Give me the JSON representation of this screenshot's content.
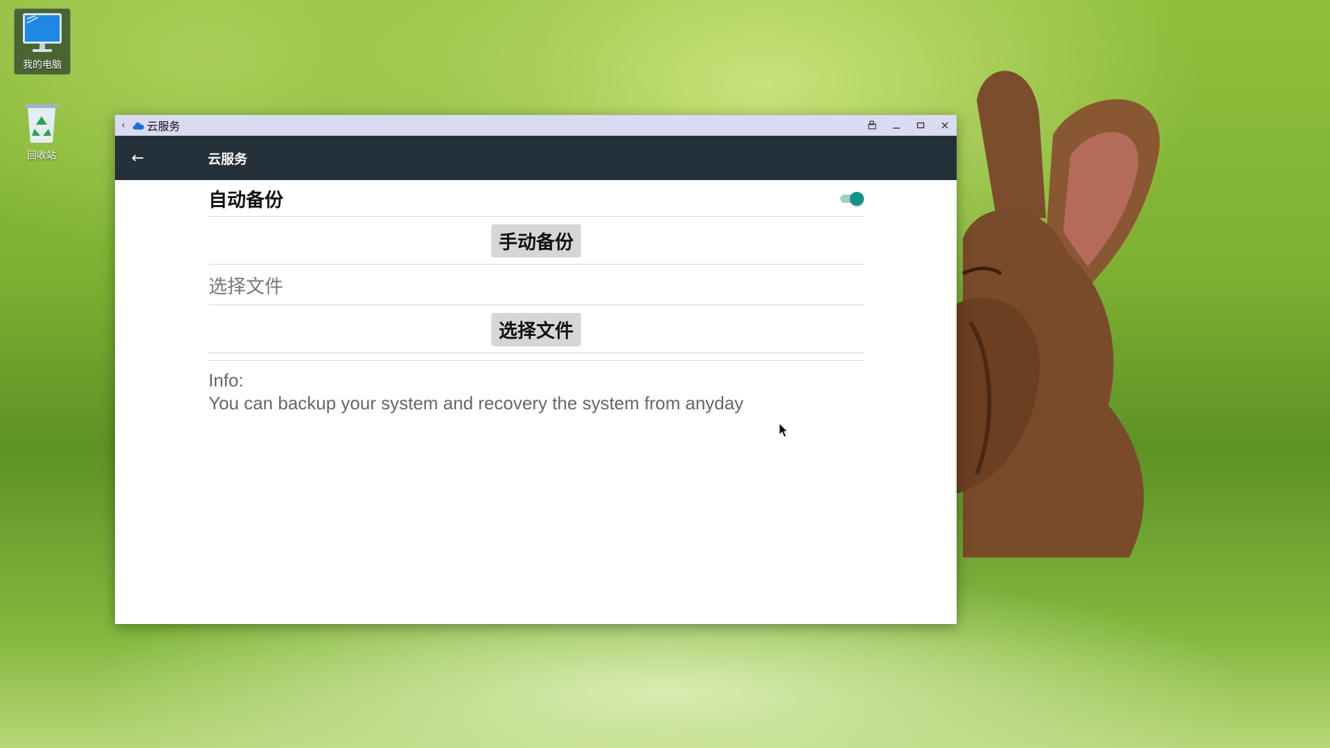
{
  "desktop": {
    "icons": [
      {
        "label": "我的电脑",
        "icon": "computer-icon"
      },
      {
        "label": "回收站",
        "icon": "recycle-bin-icon"
      }
    ]
  },
  "window": {
    "titlebar": {
      "title": "云服务",
      "back_icon": "chevron-left-icon",
      "app_icon": "cloud-icon",
      "buttons": [
        "rotate-icon",
        "minimize-icon",
        "maximize-icon",
        "close-icon"
      ]
    },
    "appbar": {
      "title": "云服务",
      "back_icon": "arrow-left-icon",
      "color": "#25313a"
    },
    "settings": {
      "auto_backup_label": "自动备份",
      "auto_backup_enabled": true,
      "manual_backup_button": "手动备份",
      "select_file_label": "选择文件",
      "select_file_button": "选择文件",
      "info_title": "Info:",
      "info_text": "You can backup your system and recovery the system from anyday"
    },
    "accent_color": "#0f9488"
  }
}
